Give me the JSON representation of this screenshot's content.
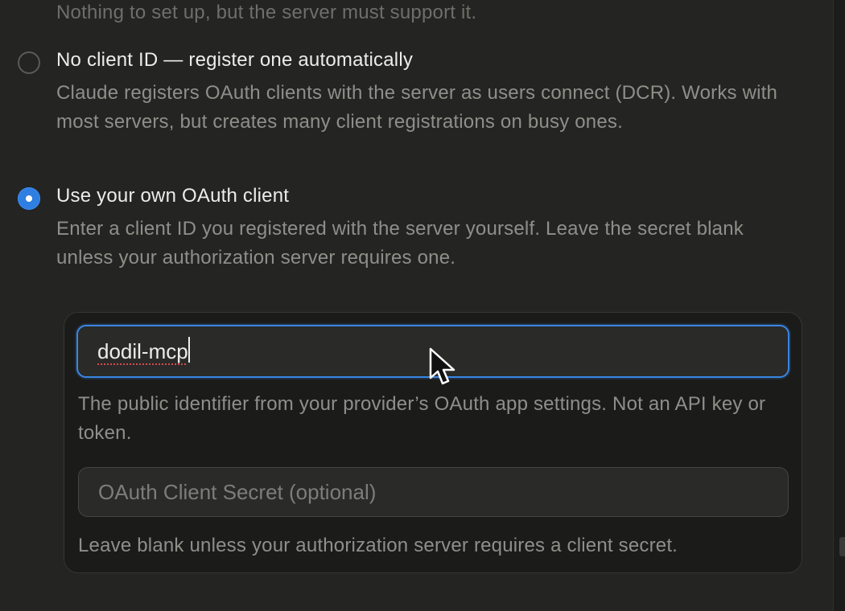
{
  "header": {
    "faded_text": "Nothing to set up, but the server must support it."
  },
  "options": [
    {
      "title": "No client ID — register one automatically",
      "description": "Claude registers OAuth clients with the server as users connect (DCR). Works with most servers, but creates many client registrations on busy ones.",
      "selected": false
    },
    {
      "title": "Use your own OAuth client",
      "description": "Enter a client ID you registered with the server yourself. Leave the secret blank unless your authorization server requires one.",
      "selected": true
    }
  ],
  "client_panel": {
    "client_id_value": "dodil-mcp",
    "client_id_help": "The public identifier from your provider’s OAuth app settings. Not an API key or token.",
    "client_secret_placeholder": "OAuth Client Secret (optional)",
    "client_secret_help": "Leave blank unless your authorization server requires a client secret."
  },
  "colors": {
    "accent": "#2f7ee2",
    "focus_border": "#3a86e4",
    "spellcheck_underline": "#d64b4b"
  },
  "icons": {
    "cursor": "mouse-pointer-icon",
    "radio_selected": "radio-checked-icon",
    "radio_unselected": "radio-unchecked-icon"
  }
}
